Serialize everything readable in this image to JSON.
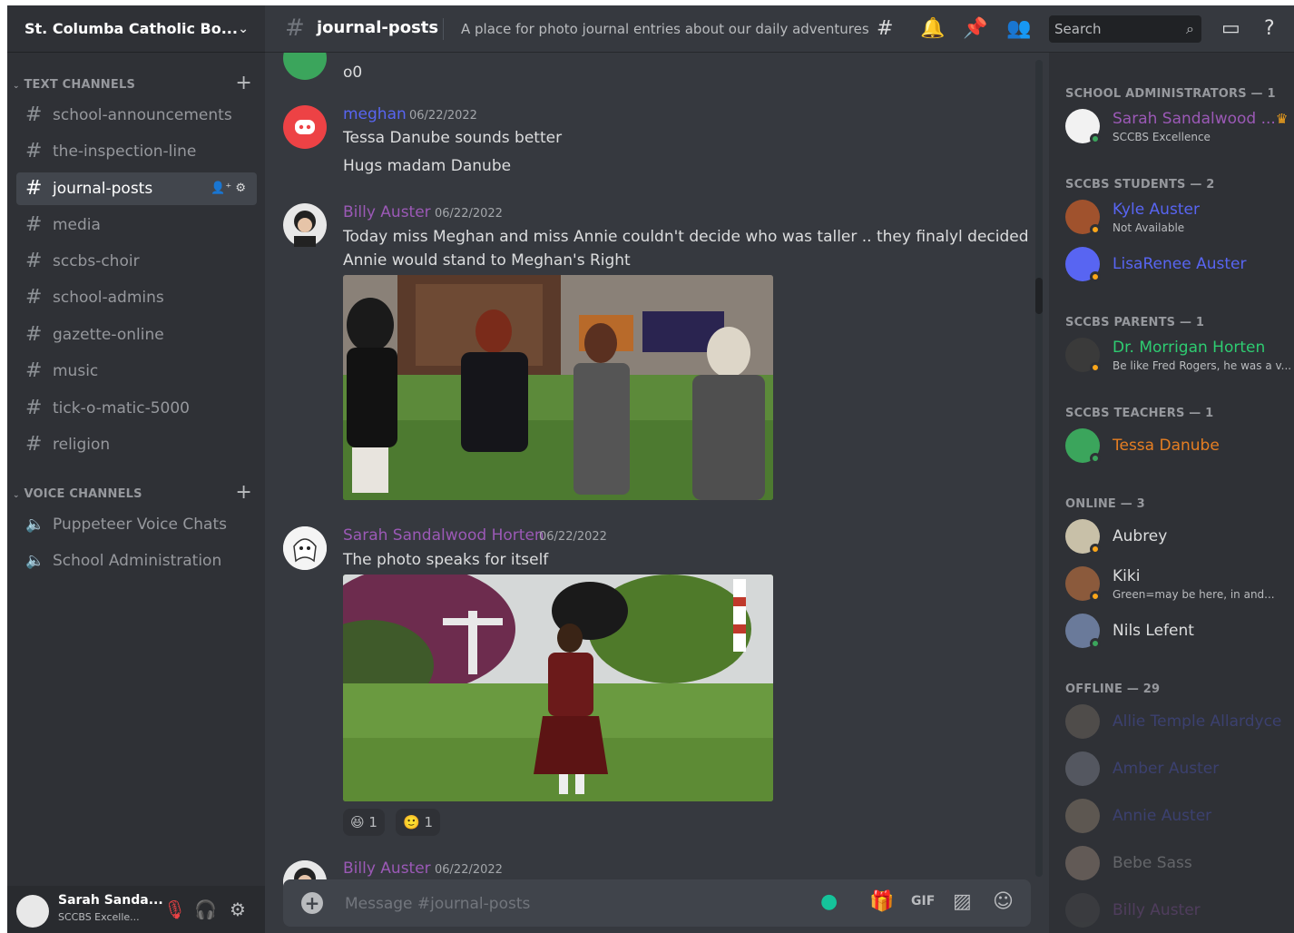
{
  "guild": {
    "name": "St. Columba Catholic Bo..."
  },
  "categories": {
    "text": "TEXT CHANNELS",
    "voice": "VOICE CHANNELS"
  },
  "text_channels": [
    "school-announcements",
    "the-inspection-line",
    "journal-posts",
    "media",
    "sccbs-choir",
    "school-admins",
    "gazette-online",
    "music",
    "tick-o-matic-5000",
    "religion"
  ],
  "voice_channels": [
    "Puppeteer Voice Chats",
    "School Administration"
  ],
  "user": {
    "name": "Sarah Sanda...",
    "status": "SCCBS Excelle..."
  },
  "channel": {
    "name": "journal-posts",
    "topic": "A place for photo journal entries about our daily adventures",
    "search_placeholder": "Search",
    "message_placeholder": "Message #journal-posts"
  },
  "messages": [
    {
      "author": "",
      "time": "",
      "lines": [
        "o0"
      ]
    },
    {
      "author": "meghan",
      "time": "06/22/2022",
      "lines": [
        "Tessa Danube sounds better",
        "Hugs madam Danube"
      ]
    },
    {
      "author": "Billy Auster",
      "time": "06/22/2022",
      "lines": [
        "Today miss Meghan and miss Annie couldn't decide who was taller .. they finalyl decided",
        "Annie would stand to Meghan's Right"
      ]
    },
    {
      "author": "Sarah Sandalwood Horten",
      "time": "06/22/2022",
      "lines": [
        "The photo speaks for itself"
      ]
    },
    {
      "author": "Billy Auster",
      "time": "06/22/2022",
      "lines": []
    }
  ],
  "reactions": [
    {
      "emoji": "😆",
      "count": "1"
    },
    {
      "emoji": "🙂",
      "count": "1"
    }
  ],
  "members": {
    "groups": [
      "SCHOOL ADMINISTRATORS — 1",
      "SCCBS STUDENTS — 2",
      "SCCBS PARENTS — 1",
      "SCCBS TEACHERS — 1",
      "ONLINE — 3",
      "OFFLINE — 29"
    ],
    "list": [
      {
        "name": "Sarah Sandalwood ...",
        "status": "SCCBS Excellence"
      },
      {
        "name": "Kyle Auster",
        "status": "Not Available"
      },
      {
        "name": "LisaRenee Auster",
        "status": ""
      },
      {
        "name": "Dr. Morrigan Horten",
        "status": "Be like Fred Rogers, he was a v..."
      },
      {
        "name": "Tessa Danube",
        "status": ""
      },
      {
        "name": "Aubrey",
        "status": ""
      },
      {
        "name": "Kiki",
        "status": "Green=may be here, in and..."
      },
      {
        "name": "Nils Lefent",
        "status": ""
      },
      {
        "name": "Allie Temple Allardyce",
        "status": ""
      },
      {
        "name": "Amber Auster",
        "status": ""
      },
      {
        "name": "Annie Auster",
        "status": ""
      },
      {
        "name": "Bebe Sass",
        "status": ""
      },
      {
        "name": "Billy Auster",
        "status": ""
      }
    ]
  },
  "colors": {
    "accent": "#5865f2",
    "admin": "#9b59b6",
    "student": "#5865f2",
    "parent": "#2ecc71",
    "teacher": "#e67e22",
    "online": "#3ba55c",
    "idle": "#faa61a"
  }
}
